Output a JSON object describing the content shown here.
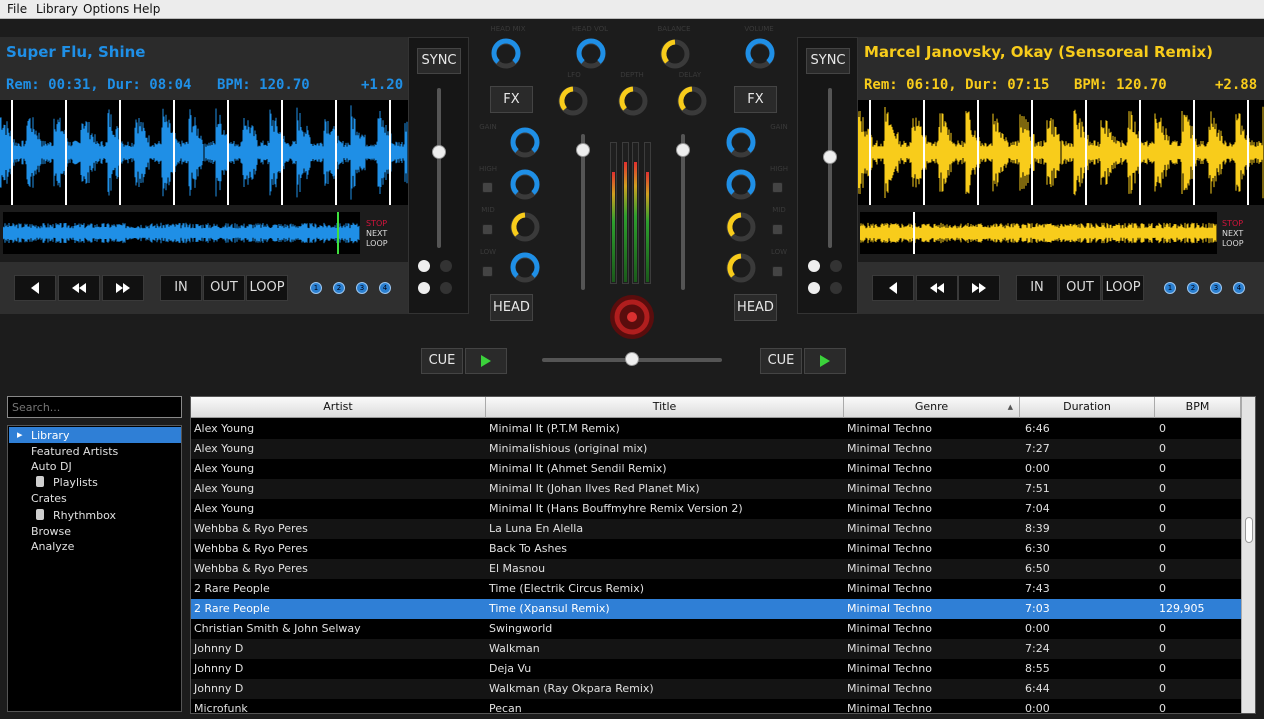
{
  "menu": {
    "file": "File",
    "library": "Library",
    "options": "Options",
    "help": "Help"
  },
  "colors": {
    "deck1": "#1f8fe6",
    "deck2": "#f8cc1b",
    "accent_knob_blue": "#1f8fe6",
    "accent_knob_yellow": "#f8cc1b",
    "selection": "#2f7fd6"
  },
  "deck1": {
    "title": "Super Flu, Shine",
    "rem_dur": "Rem: 00:31, Dur: 08:04",
    "bpm": "BPM: 120.70",
    "pitch": "+1.20",
    "stop": "STOP",
    "next": "NEXT",
    "loop_label": "LOOP",
    "sync": "SYNC",
    "fx": "FX",
    "head": "HEAD",
    "cue": "CUE",
    "in": "IN",
    "out": "OUT",
    "loop": "LOOP",
    "hotcues": [
      "1",
      "2",
      "3",
      "4"
    ],
    "position": 0.94,
    "pitch_slider": 0.4
  },
  "deck2": {
    "title": "Marcel Janovsky, Okay (Sensoreal Remix)",
    "rem_dur": "Rem: 06:10, Dur: 07:15",
    "bpm": "BPM: 120.70",
    "pitch": "+2.88",
    "stop": "STOP",
    "next": "NEXT",
    "loop_label": "LOOP",
    "sync": "SYNC",
    "fx": "FX",
    "head": "HEAD",
    "cue": "CUE",
    "in": "IN",
    "out": "OUT",
    "loop": "LOOP",
    "hotcues": [
      "1",
      "2",
      "3",
      "4"
    ],
    "position": 0.15,
    "pitch_slider": 0.43
  },
  "mixer": {
    "crossfader": 0.5,
    "channel1_volume": 0.9,
    "channel2_volume": 0.9
  },
  "search": {
    "placeholder": "Search..."
  },
  "sidebar": {
    "items": [
      {
        "label": "Library",
        "selected": true
      },
      {
        "label": "Featured Artists"
      },
      {
        "label": "Auto DJ"
      },
      {
        "label": "Playlists"
      },
      {
        "label": "Crates"
      },
      {
        "label": "Rhythmbox"
      },
      {
        "label": "Browse"
      },
      {
        "label": "Analyze"
      }
    ]
  },
  "library": {
    "columns": [
      "Artist",
      "Title",
      "Genre",
      "Duration",
      "BPM"
    ],
    "rows": [
      [
        "Alex Young",
        "Minimal It (P.T.M Remix)",
        "Minimal Techno",
        "6:46",
        "0"
      ],
      [
        "Alex Young",
        "Minimalishious (original mix)",
        "Minimal Techno",
        "7:27",
        "0"
      ],
      [
        "Alex Young",
        "Minimal It (Ahmet Sendil Remix)",
        "Minimal Techno",
        "0:00",
        "0"
      ],
      [
        "Alex Young",
        "Minimal It (Johan Ilves Red Planet Mix)",
        "Minimal Techno",
        "7:51",
        "0"
      ],
      [
        "Alex Young",
        "Minimal It (Hans Bouffmyhre Remix Version 2)",
        "Minimal Techno",
        "7:04",
        "0"
      ],
      [
        "Wehbba & Ryo Peres",
        "La Luna En Alella",
        "Minimal Techno",
        "8:39",
        "0"
      ],
      [
        "Wehbba & Ryo Peres",
        "Back To Ashes",
        "Minimal Techno",
        "6:30",
        "0"
      ],
      [
        "Wehbba & Ryo Peres",
        "El Masnou",
        "Minimal Techno",
        "6:50",
        "0"
      ],
      [
        "2 Rare People",
        "Time (Electrik Circus Remix)",
        "Minimal Techno",
        "7:43",
        "0"
      ],
      [
        "2 Rare People",
        "Time (Xpansul Remix)",
        "Minimal Techno",
        "7:03",
        "129,905"
      ],
      [
        "Christian Smith & John Selway",
        "Swingworld",
        "Minimal Techno",
        "0:00",
        "0"
      ],
      [
        "Johnny D",
        "Walkman",
        "Minimal Techno",
        "7:24",
        "0"
      ],
      [
        "Johnny D",
        "Deja Vu",
        "Minimal Techno",
        "8:55",
        "0"
      ],
      [
        "Johnny D",
        "Walkman (Ray Okpara Remix)",
        "Minimal Techno",
        "6:44",
        "0"
      ],
      [
        "Microfunk",
        "Pecan",
        "Minimal Techno",
        "0:00",
        "0"
      ]
    ],
    "selected_row": 9
  }
}
